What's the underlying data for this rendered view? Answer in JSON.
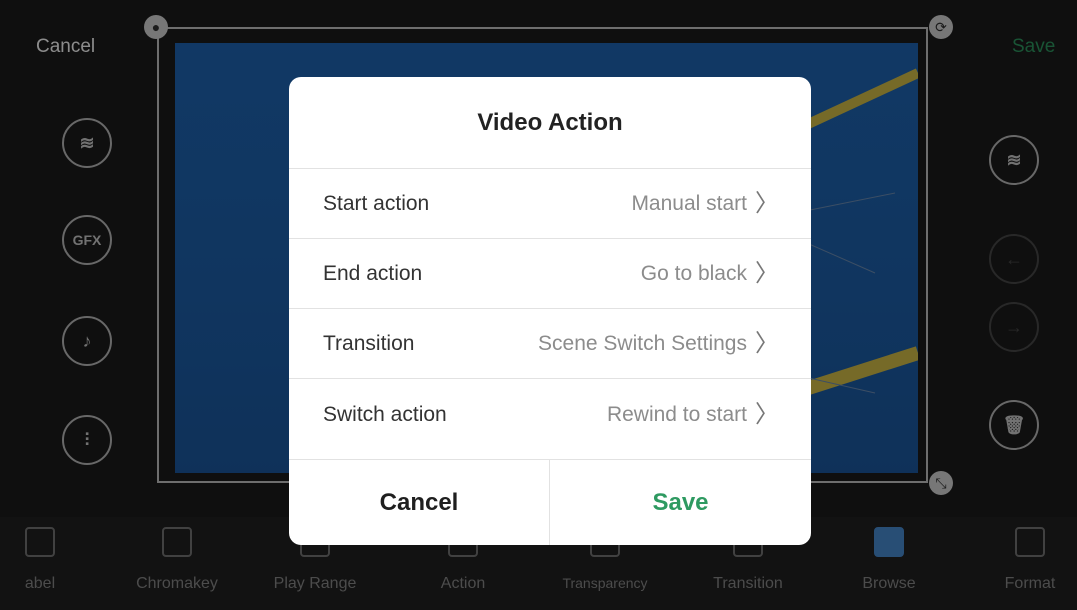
{
  "topbar": {
    "cancel_label": "Cancel",
    "save_label": "Save"
  },
  "side_left": [
    {
      "name": "add-layer",
      "glyph": "≋"
    },
    {
      "name": "add-gfx",
      "glyph": "GFX"
    },
    {
      "name": "add-music",
      "glyph": "♪"
    },
    {
      "name": "mixer",
      "glyph": "⫶"
    }
  ],
  "side_right": [
    {
      "name": "layer-select",
      "glyph": "≋"
    },
    {
      "name": "back",
      "glyph": "←"
    },
    {
      "name": "forward",
      "glyph": "→"
    },
    {
      "name": "delete",
      "glyph": "🗑"
    }
  ],
  "toolbar": {
    "items": [
      {
        "label": "abel"
      },
      {
        "label": "Chromakey"
      },
      {
        "label": "Play Range"
      },
      {
        "label": "Action"
      },
      {
        "label": "Transparency"
      },
      {
        "label": "Transition"
      },
      {
        "label": "Browse"
      },
      {
        "label": "Format"
      }
    ]
  },
  "dialog": {
    "title": "Video Action",
    "rows": [
      {
        "label": "Start action",
        "value": "Manual start"
      },
      {
        "label": "End action",
        "value": "Go to black"
      },
      {
        "label": "Transition",
        "value": "Scene Switch Settings"
      },
      {
        "label": "Switch action",
        "value": "Rewind to start"
      }
    ],
    "cancel_label": "Cancel",
    "save_label": "Save",
    "accent_color": "#2e9a61"
  }
}
